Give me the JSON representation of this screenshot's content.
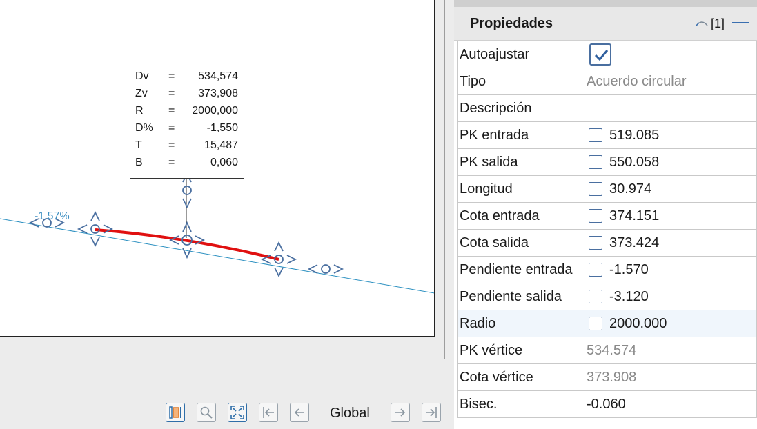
{
  "drawing": {
    "slope_label": "-1.57%",
    "info_box": [
      {
        "key": "Dv",
        "eq": "=",
        "value": "534,574"
      },
      {
        "key": "Zv",
        "eq": "=",
        "value": "373,908"
      },
      {
        "key": "R",
        "eq": "=",
        "value": "2000,000"
      },
      {
        "key": "D%",
        "eq": "=",
        "value": "-1,550"
      },
      {
        "key": "T",
        "eq": "=",
        "value": "15,487"
      },
      {
        "key": "B",
        "eq": "=",
        "value": "0,060"
      }
    ],
    "colors": {
      "alignment": "#2a8fc0",
      "curve": "#e01010",
      "handles": "#4a6fa0"
    }
  },
  "toolbar": {
    "global_label": "Global",
    "buttons": [
      "highlight-icon",
      "zoom-icon",
      "fit-extents-icon",
      "first-icon",
      "previous-icon",
      "next-icon",
      "last-icon"
    ]
  },
  "properties": {
    "title": "Propiedades",
    "counter": "[1]",
    "rows": [
      {
        "name": "Autoajustar",
        "type": "bigcheck",
        "checked": true,
        "value": ""
      },
      {
        "name": "Tipo",
        "type": "text",
        "value": "Acuerdo circular",
        "gray": true
      },
      {
        "name": "Descripción",
        "type": "text",
        "value": ""
      },
      {
        "name": "PK entrada",
        "type": "check",
        "checked": false,
        "value": "519.085"
      },
      {
        "name": "PK salida",
        "type": "check",
        "checked": false,
        "value": "550.058"
      },
      {
        "name": "Longitud",
        "type": "check",
        "checked": false,
        "value": "30.974"
      },
      {
        "name": "Cota entrada",
        "type": "check",
        "checked": false,
        "value": "374.151"
      },
      {
        "name": "Cota salida",
        "type": "check",
        "checked": false,
        "value": "373.424"
      },
      {
        "name": "Pendiente entrada",
        "type": "check",
        "checked": false,
        "value": "-1.570"
      },
      {
        "name": "Pendiente salida",
        "type": "check",
        "checked": false,
        "value": "-3.120"
      },
      {
        "name": "Radio",
        "type": "check",
        "checked": false,
        "value": "2000.000",
        "selected": true
      },
      {
        "name": "PK vértice",
        "type": "text",
        "value": "534.574",
        "gray": true
      },
      {
        "name": "Cota vértice",
        "type": "text",
        "value": "373.908",
        "gray": true
      },
      {
        "name": "Bisec.",
        "type": "text",
        "value": "-0.060"
      }
    ]
  }
}
